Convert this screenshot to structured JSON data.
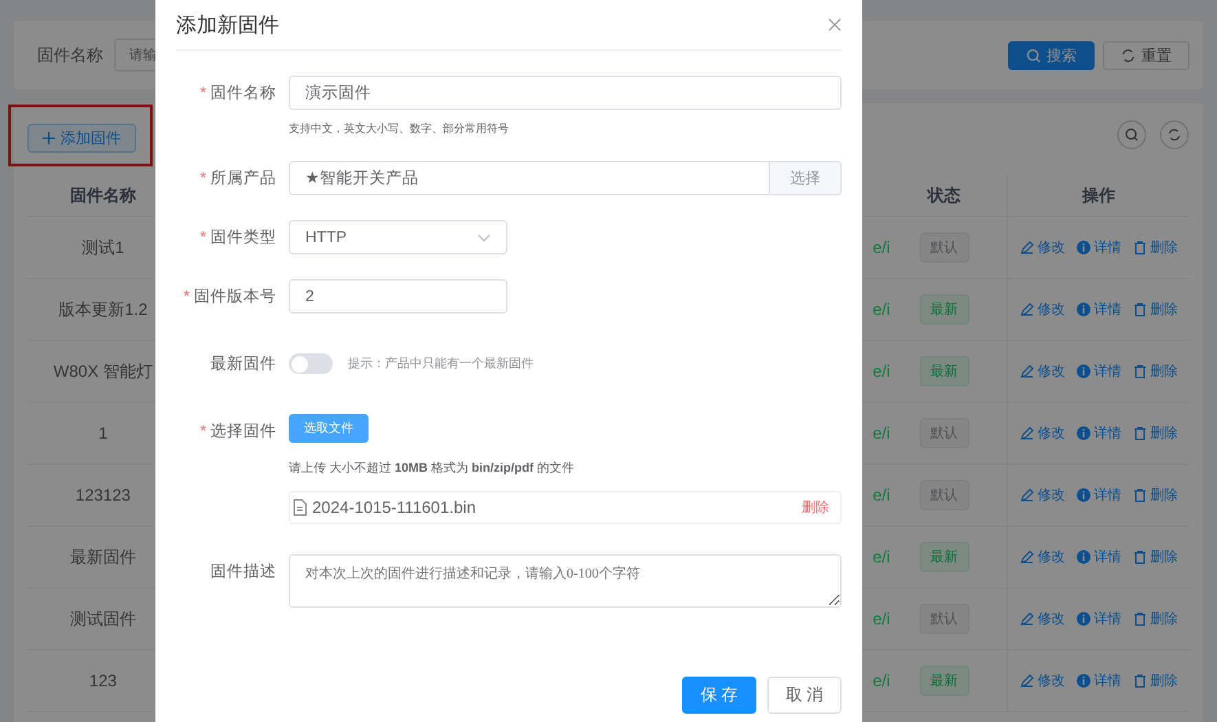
{
  "search_bar": {
    "label": "固件名称",
    "placeholder": "请输",
    "buttons": [
      {
        "label": "搜索",
        "kind": "primary"
      },
      {
        "label": "重置",
        "kind": "default"
      }
    ]
  },
  "toolbar": {
    "add_button": "添加固件"
  },
  "table": {
    "columns": [
      "固件名称",
      "状态",
      "操作"
    ],
    "rows": [
      {
        "name": "测试1",
        "column_2": "e/i",
        "status": "默认",
        "latest": false,
        "actions": [
          "修改",
          "详情",
          "删除"
        ]
      },
      {
        "name": "版本更新1.2",
        "column_2": "e/i",
        "status": "最新",
        "latest": true,
        "actions": [
          "修改",
          "详情",
          "删除"
        ]
      },
      {
        "name": "W80X 智能灯",
        "column_2": "e/i",
        "status": "最新",
        "latest": true,
        "actions": [
          "修改",
          "详情",
          "删除"
        ]
      },
      {
        "name": "1",
        "column_2": "e/i",
        "status": "默认",
        "latest": false,
        "actions": [
          "修改",
          "详情",
          "删除"
        ]
      },
      {
        "name": "123123",
        "column_2": "e/i",
        "status": "默认",
        "latest": false,
        "actions": [
          "修改",
          "详情",
          "删除"
        ]
      },
      {
        "name": "最新固件",
        "column_2": "e/i",
        "status": "最新",
        "latest": true,
        "actions": [
          "修改",
          "详情",
          "删除"
        ]
      },
      {
        "name": "测试固件",
        "column_2": "e/i",
        "status": "默认",
        "latest": false,
        "actions": [
          "修改",
          "详情",
          "删除"
        ]
      },
      {
        "name": "123",
        "column_2": "e/i",
        "status": "最新",
        "latest": true,
        "actions": [
          "修改",
          "详情",
          "删除"
        ]
      }
    ]
  },
  "dialog": {
    "title": "添加新固件",
    "fields": [
      {
        "kind": "text",
        "label": "固件名称",
        "required_mark": "*",
        "value": "演示固件",
        "hint": "支持中文，英文大小写、数字、部分常用符号"
      },
      {
        "kind": "picker",
        "label": "所属产品",
        "required_mark": "*",
        "value": "★智能开关产品",
        "button": "选择"
      },
      {
        "kind": "select",
        "label": "固件类型",
        "required_mark": "*",
        "value": "HTTP"
      },
      {
        "kind": "short",
        "label": "固件版本号",
        "required_mark": "*",
        "value": "2"
      },
      {
        "kind": "toggle",
        "label": "最新固件",
        "on": false,
        "hint": "提示：产品中只能有一个最新固件"
      },
      {
        "kind": "upload",
        "label": "选择固件",
        "required_mark": "*",
        "button": "选取文件",
        "tip": "请上传 大小不超过 **10MB** 格式为 **bin/zip/pdf** 的文件",
        "file": "2024-1015-111601.bin",
        "remove": "删除"
      },
      {
        "kind": "textarea",
        "label": "固件描述",
        "placeholder": "对本次上次的固件进行描述和记录，请输入0-100个字符"
      }
    ],
    "buttons": [
      {
        "label": "保 存",
        "kind": "primary"
      },
      {
        "label": "取 消",
        "kind": "default"
      }
    ]
  }
}
